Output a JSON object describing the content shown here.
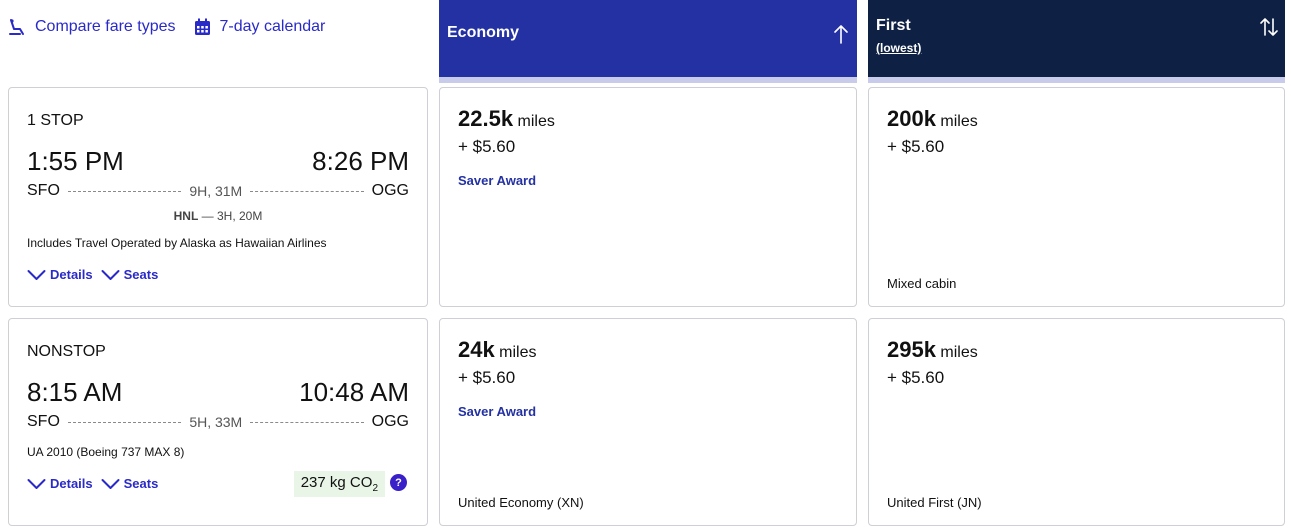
{
  "toolbar": {
    "compare_label": "Compare fare types",
    "calendar_label": "7-day calendar"
  },
  "columns": {
    "economy": {
      "title": "Economy",
      "color": "#2331a3"
    },
    "first": {
      "title": "First",
      "subtitle": "(lowest)",
      "color": "#0e2144"
    }
  },
  "flights": [
    {
      "stops": "1 STOP",
      "depart": "1:55 PM",
      "arrive": "8:26 PM",
      "origin": "SFO",
      "destination": "OGG",
      "duration": "9H, 31M",
      "connection_airport": "HNL",
      "connection_time": "— 3H, 20M",
      "note": "Includes Travel Operated by Alaska as Hawaiian Airlines",
      "details_label": "Details",
      "seats_label": "Seats",
      "economy": {
        "miles": "22.5k",
        "unit": "miles",
        "tax": "+ $5.60",
        "award": "Saver Award",
        "cabin": ""
      },
      "first": {
        "miles": "200k",
        "unit": "miles",
        "tax": "+ $5.60",
        "award": "",
        "cabin": "Mixed cabin"
      }
    },
    {
      "stops": "NONSTOP",
      "depart": "8:15 AM",
      "arrive": "10:48 AM",
      "origin": "SFO",
      "destination": "OGG",
      "duration": "5H, 33M",
      "note": "UA 2010 (Boeing 737 MAX 8)",
      "details_label": "Details",
      "seats_label": "Seats",
      "co2": "237 kg CO",
      "co2_sub": "2",
      "help": "?",
      "economy": {
        "miles": "24k",
        "unit": "miles",
        "tax": "+ $5.60",
        "award": "Saver Award",
        "cabin": "United Economy (XN)"
      },
      "first": {
        "miles": "295k",
        "unit": "miles",
        "tax": "+ $5.60",
        "award": "",
        "cabin": "United First (JN)"
      }
    }
  ]
}
